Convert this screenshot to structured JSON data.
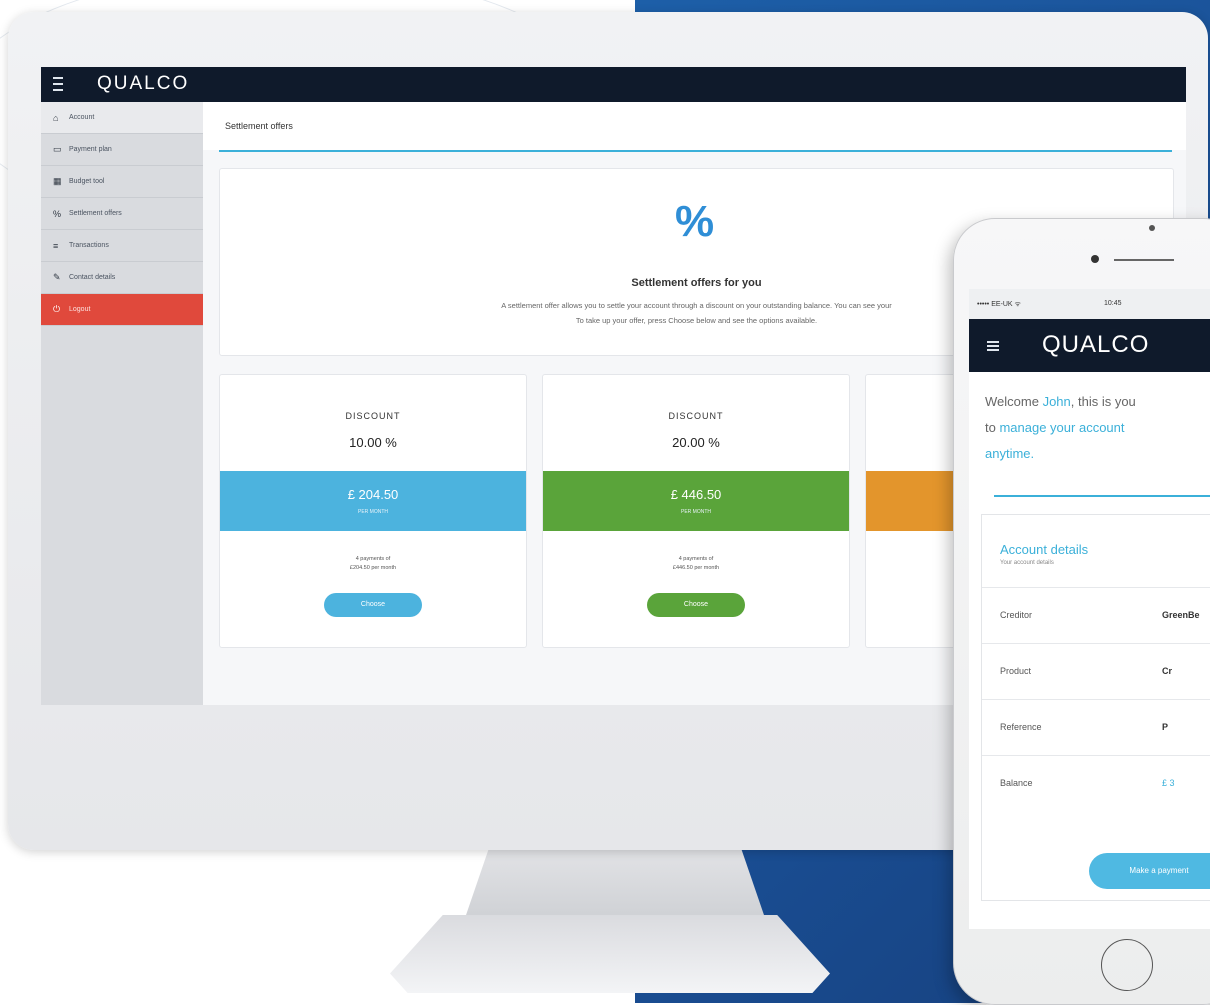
{
  "colors": {
    "accent": "#3bb0d9",
    "topbar": "#0f1a2b",
    "danger": "#e0493c",
    "green": "#5aa43a",
    "orange": "#e3952c",
    "blue_band": "#4cb3de"
  },
  "desktop": {
    "brand": "QUALCO",
    "sidebar": {
      "items": [
        {
          "icon": "home-icon",
          "glyph": "⌂",
          "label": "Account"
        },
        {
          "icon": "calendar-icon",
          "glyph": "▭",
          "label": "Payment plan"
        },
        {
          "icon": "calculator-icon",
          "glyph": "▦",
          "label": "Budget tool"
        },
        {
          "icon": "percent-icon",
          "glyph": "%",
          "label": "Settlement offers"
        },
        {
          "icon": "list-icon",
          "glyph": "≡",
          "label": "Transactions"
        },
        {
          "icon": "contact-icon",
          "glyph": "✎",
          "label": "Contact details"
        },
        {
          "icon": "logout-icon",
          "glyph": "⏻",
          "label": "Logout"
        }
      ]
    },
    "page_title": "Settlement offers",
    "hero": {
      "symbol": "%",
      "title": "Settlement offers for you",
      "description_line1": "A settlement offer allows you to settle your account through a discount on your outstanding balance. You can see your",
      "description_line2": "To take up your offer, press Choose below and see the options available."
    },
    "offers": [
      {
        "label": "DISCOUNT",
        "percent": "10.00 %",
        "amount": "£ 204.50",
        "amount_sub": "PER MONTH",
        "note_line1": "4 payments of",
        "note_line2": "£204.50 per month",
        "button": "Choose"
      },
      {
        "label": "DISCOUNT",
        "percent": "20.00 %",
        "amount": "£ 446.50",
        "amount_sub": "PER MONTH",
        "note_line1": "4 payments of",
        "note_line2": "£446.50 per month",
        "button": "Choose"
      }
    ]
  },
  "mobile": {
    "status_carrier": "••••• EE-UK ᯤ",
    "status_time": "10:45",
    "brand": "QUALCO",
    "welcome_prefix": "Welcome ",
    "welcome_name": "John",
    "welcome_line1_rest": ", this is you",
    "welcome_line2_prefix": "to ",
    "welcome_line2_link": "manage your account",
    "welcome_line3": "anytime.",
    "card_title": "Account details",
    "card_subtitle": "Your account details",
    "rows": [
      {
        "key": "Creditor",
        "value": "GreenBe"
      },
      {
        "key": "Product",
        "value": "Cr"
      },
      {
        "key": "Reference",
        "value": "P"
      },
      {
        "key": "Balance",
        "value": "£ 3"
      }
    ],
    "pay_button": "Make a payment"
  }
}
